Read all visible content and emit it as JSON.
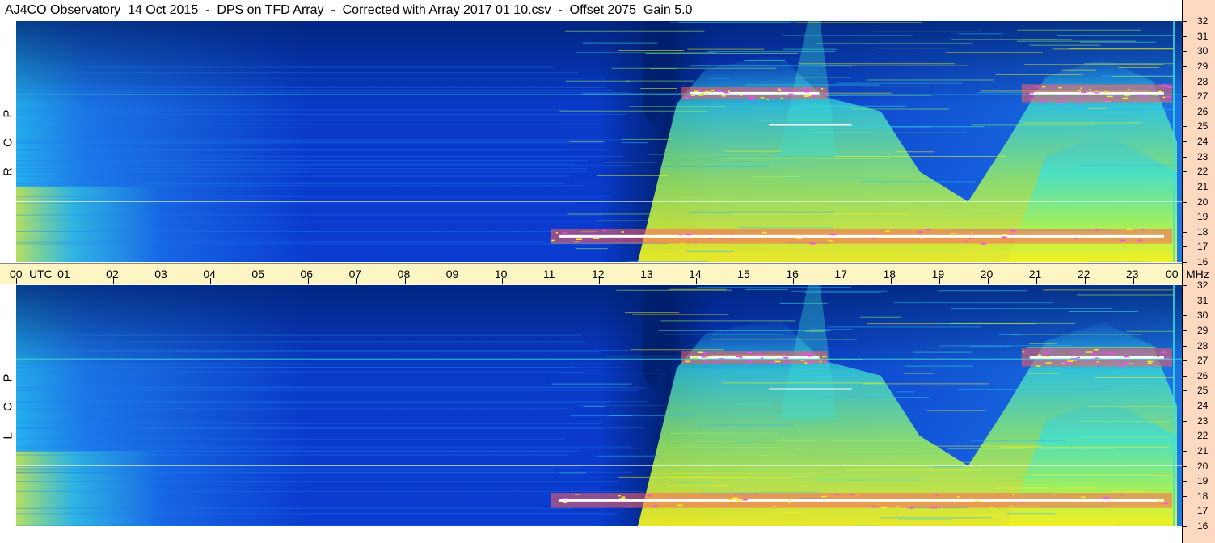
{
  "window": {
    "title": "AJ4CO Observatory  14 Oct 2015  -  DPS on TFD Array  -  Corrected with Array 2017 01 10.csv  -  Offset 2075  Gain 5.0"
  },
  "time_axis": {
    "labels": [
      "00",
      "01",
      "02",
      "03",
      "04",
      "05",
      "06",
      "07",
      "08",
      "09",
      "10",
      "11",
      "12",
      "13",
      "14",
      "15",
      "16",
      "17",
      "18",
      "19",
      "20",
      "21",
      "22",
      "23",
      "00"
    ],
    "utc_label": "UTC",
    "mhz_label": "MHz"
  },
  "chart_data": [
    {
      "type": "heatmap",
      "panel": "R C P",
      "polarization_label": [
        "R",
        "C",
        "P"
      ],
      "x_label": "UTC",
      "y_label": "MHz",
      "xlim": [
        0,
        24
      ],
      "ylim": [
        16,
        32
      ],
      "y_ticks": [
        16,
        17,
        18,
        19,
        20,
        21,
        22,
        23,
        24,
        25,
        26,
        27,
        28,
        29,
        30,
        31,
        32
      ],
      "features": [
        {
          "name": "daytime broadband rise",
          "x_range": [
            13.5,
            23.8
          ],
          "y_range": [
            16,
            29
          ]
        },
        {
          "name": "RFI band 27 MHz",
          "x_range": [
            13.7,
            16.7
          ],
          "y_range": [
            26.8,
            27.6
          ]
        },
        {
          "name": "RFI band 27 MHz",
          "x_range": [
            20.7,
            23.8
          ],
          "y_range": [
            26.6,
            27.8
          ]
        },
        {
          "name": "RFI band 17.5 MHz",
          "x_range": [
            11.0,
            23.8
          ],
          "y_range": [
            17.2,
            18.2
          ]
        }
      ],
      "colors": [
        "#00206f",
        "#0a3cd0",
        "#1e7df0",
        "#27b8f5",
        "#3ce0d5",
        "#9cf060",
        "#f4f020",
        "#ff6060",
        "#ff40ff",
        "#ffffff"
      ]
    },
    {
      "type": "heatmap",
      "panel": "L C P",
      "polarization_label": [
        "L",
        "C",
        "P"
      ],
      "x_label": "UTC",
      "y_label": "MHz",
      "xlim": [
        0,
        24
      ],
      "ylim": [
        16,
        32
      ],
      "y_ticks": [
        16,
        17,
        18,
        19,
        20,
        21,
        22,
        23,
        24,
        25,
        26,
        27,
        28,
        29,
        30,
        31,
        32
      ],
      "features": [
        {
          "name": "daytime broadband rise",
          "x_range": [
            13.5,
            23.8
          ],
          "y_range": [
            16,
            29
          ]
        },
        {
          "name": "RFI band 27 MHz",
          "x_range": [
            13.7,
            16.7
          ],
          "y_range": [
            26.8,
            27.6
          ]
        },
        {
          "name": "RFI band 27 MHz",
          "x_range": [
            20.7,
            23.8
          ],
          "y_range": [
            26.6,
            27.8
          ]
        },
        {
          "name": "RFI band 17.5 MHz",
          "x_range": [
            11.0,
            23.8
          ],
          "y_range": [
            17.2,
            18.2
          ]
        }
      ],
      "colors": [
        "#00206f",
        "#0a3cd0",
        "#1e7df0",
        "#27b8f5",
        "#3ce0d5",
        "#9cf060",
        "#f4f020",
        "#ff6060",
        "#ff40ff",
        "#ffffff"
      ]
    }
  ]
}
